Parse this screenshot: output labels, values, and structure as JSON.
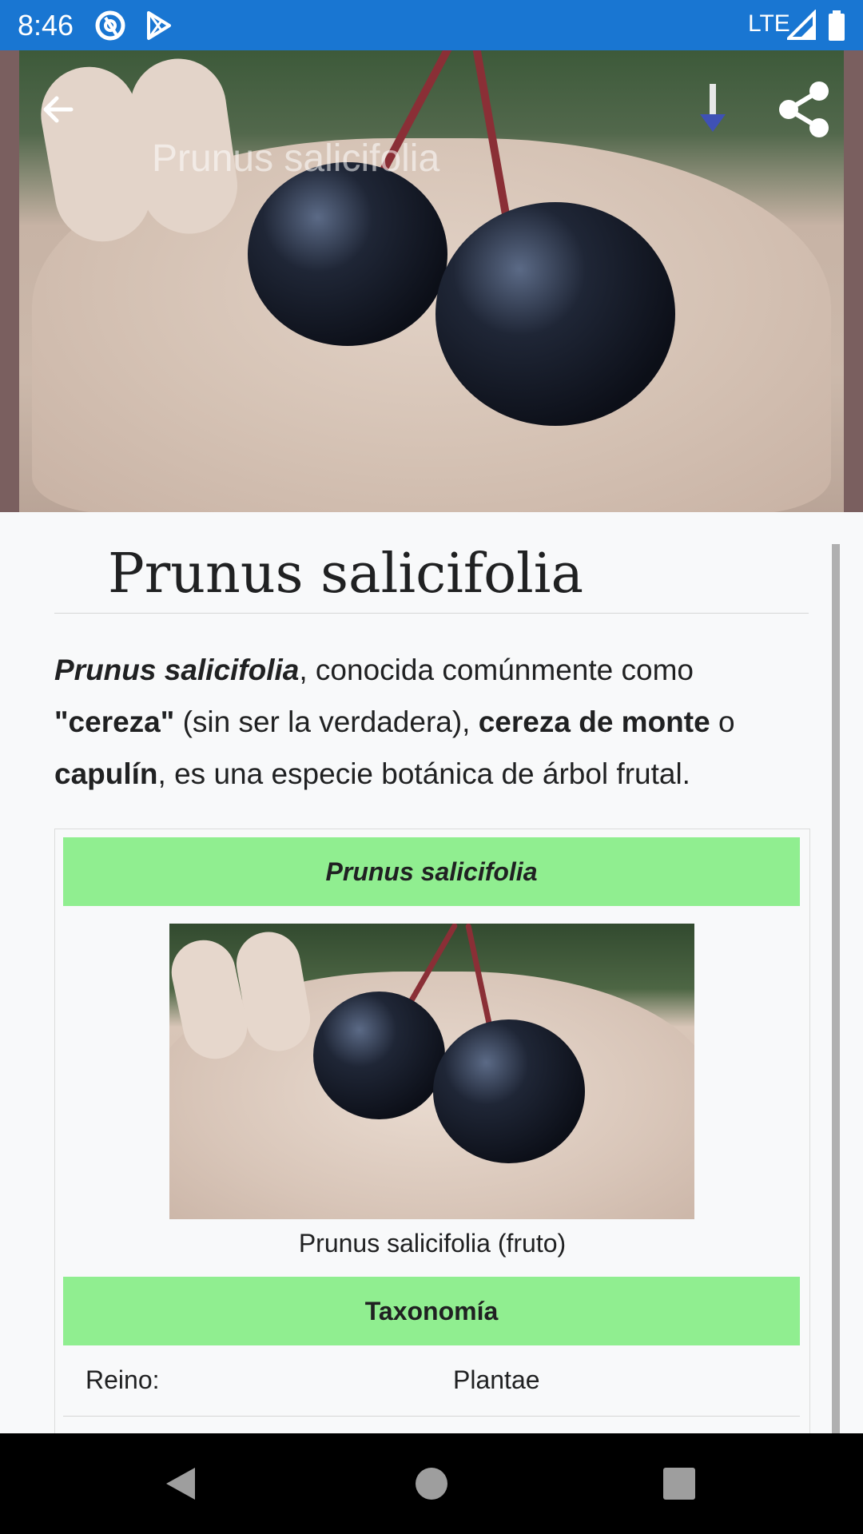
{
  "status_bar": {
    "time": "8:46",
    "network": "LTE",
    "icons": [
      "at-sign-icon",
      "play-store-icon",
      "signal-icon",
      "battery-icon"
    ]
  },
  "app_bar": {
    "title": "Prunus salicifolia",
    "back_icon": "back-arrow-icon",
    "download_icon": "download-icon",
    "share_icon": "share-icon"
  },
  "article": {
    "title": "Prunus salicifolia",
    "lead": {
      "part1_bold_italic": "Prunus salicifolia",
      "part2": ", conocida comúnmente como ",
      "part3_bold": "\"cereza\"",
      "part4": " (sin ser la verdadera), ",
      "part5_bold": "cereza de monte",
      "part6": " o ",
      "part7_bold": "capulín",
      "part8": ", es una especie botánica de árbol frutal."
    }
  },
  "infobox": {
    "header": "Prunus salicifolia",
    "image_caption": "Prunus salicifolia (fruto)",
    "taxonomy_header": "Taxonomía",
    "rows": [
      {
        "label": "Reino:",
        "value": "Plantae"
      }
    ],
    "header_color": "#90ee90"
  },
  "nav_bar": {
    "back": "nav-back-icon",
    "home": "nav-home-icon",
    "recents": "nav-recents-icon"
  },
  "colors": {
    "status_bar": "#1976d2",
    "background": "#f8f9fa",
    "infobox_header": "#90ee90"
  }
}
